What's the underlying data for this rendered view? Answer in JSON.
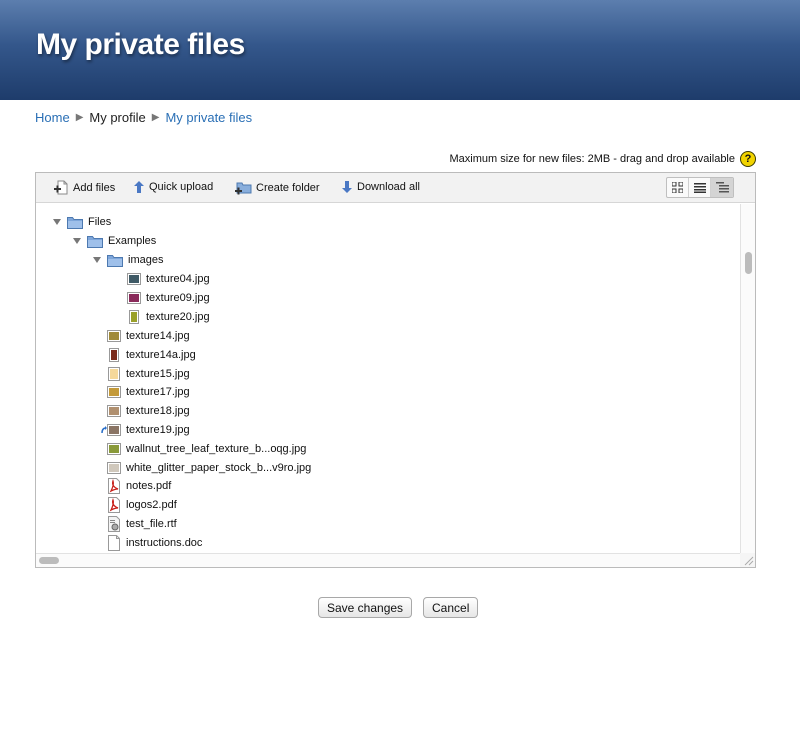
{
  "header": {
    "title": "My private files"
  },
  "breadcrumb": {
    "home": "Home",
    "profile": "My profile",
    "current": "My private files"
  },
  "filemanager": {
    "max_size_text": "Maximum size for new files: 2MB - drag and drop available",
    "help_glyph": "?",
    "toolbar": {
      "add_files": "Add files",
      "quick_upload": "Quick upload",
      "create_folder": "Create folder",
      "download_all": "Download all"
    },
    "views": [
      "icons-view-icon",
      "list-view-icon",
      "tree-view-icon"
    ],
    "active_view": "tree-view-icon",
    "tree": [
      {
        "label": "Files",
        "type": "folder",
        "expanded": true
      },
      {
        "label": "Examples",
        "type": "folder",
        "expanded": true
      },
      {
        "label": "images",
        "type": "folder",
        "expanded": true
      },
      {
        "label": "texture04.jpg",
        "type": "image"
      },
      {
        "label": "texture09.jpg",
        "type": "image"
      },
      {
        "label": "texture20.jpg",
        "type": "image"
      },
      {
        "label": "texture14.jpg",
        "type": "image"
      },
      {
        "label": "texture14a.jpg",
        "type": "image"
      },
      {
        "label": "texture15.jpg",
        "type": "image"
      },
      {
        "label": "texture17.jpg",
        "type": "image"
      },
      {
        "label": "texture18.jpg",
        "type": "image"
      },
      {
        "label": "texture19.jpg",
        "type": "image-alias"
      },
      {
        "label": "wallnut_tree_leaf_texture_b...oqg.jpg",
        "type": "image"
      },
      {
        "label": "white_glitter_paper_stock_b...v9ro.jpg",
        "type": "image"
      },
      {
        "label": "notes.pdf",
        "type": "pdf"
      },
      {
        "label": "logos2.pdf",
        "type": "pdf"
      },
      {
        "label": "test_file.rtf",
        "type": "rtf"
      },
      {
        "label": "instructions.doc",
        "type": "doc"
      }
    ]
  },
  "actions": {
    "save": "Save changes",
    "cancel": "Cancel"
  },
  "colors": {
    "header_top": "#5c7eae",
    "header_bottom": "#1e3c6b",
    "link": "#2a6fb5",
    "folder": "#6d9ad2"
  }
}
